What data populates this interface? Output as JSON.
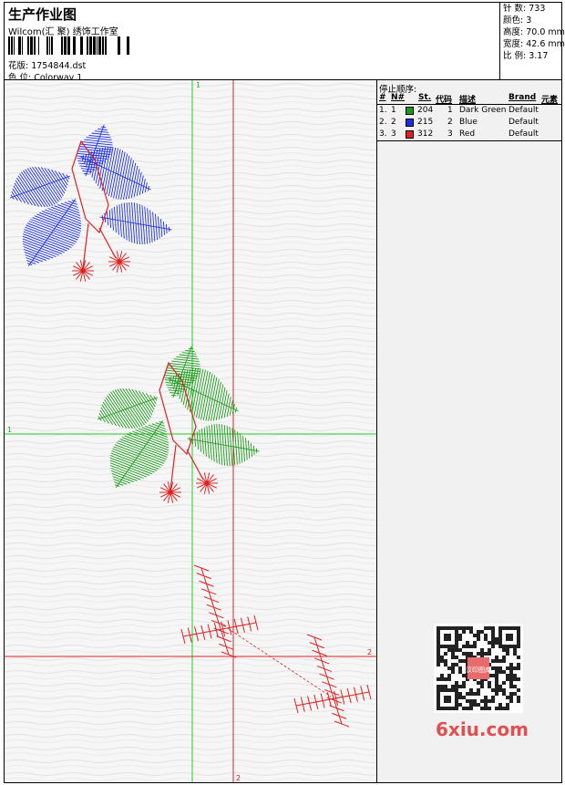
{
  "header": {
    "title": "生产作业图",
    "company": "Wilcom(汇 聚) 绣饰工作室",
    "file_label": "花版: 1754844.dst",
    "colorway_label": "色 位:  Colorway 1"
  },
  "stats": {
    "stitches": "针 数: 733",
    "colors": "颜色: 3",
    "height": "高度: 70.0 mm",
    "width": "宽度: 42.6 mm",
    "scale": "比 例: 3.17"
  },
  "sequence": {
    "title": "停止顺序:",
    "headers": {
      "num": "#",
      "no": "N#",
      "st": "St.",
      "code": "代码",
      "desc": "描述",
      "brand": "Brand",
      "element": "元素"
    },
    "rows": [
      {
        "num": "1.",
        "no": "1",
        "st": "204",
        "code": "1",
        "desc": "Dark Green",
        "brand": "Default",
        "color": "#1a9a1a"
      },
      {
        "num": "2.",
        "no": "2",
        "st": "215",
        "code": "2",
        "desc": "Blue",
        "brand": "Default",
        "color": "#1b2fe0"
      },
      {
        "num": "3.",
        "no": "3",
        "st": "312",
        "code": "3",
        "desc": "Red",
        "brand": "Default",
        "color": "#e02020"
      }
    ]
  },
  "guides": {
    "green_label_1": "1",
    "green_label_2": "1",
    "red_label_1": "2",
    "red_label_2": "2"
  },
  "watermark": {
    "brand": "6xiu.com",
    "seal": "汉印图库"
  },
  "colors": {
    "green": "#1a9a1a",
    "blue": "#1b2fe0",
    "red": "#e02020"
  }
}
